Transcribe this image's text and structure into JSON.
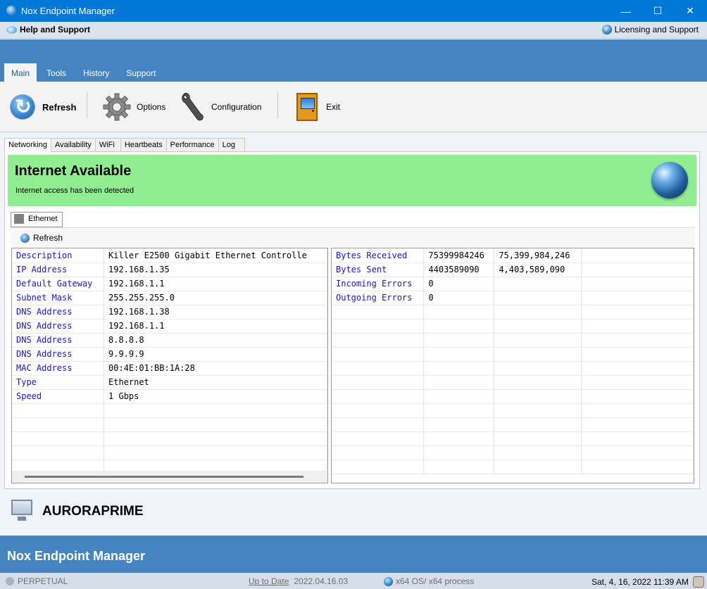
{
  "window": {
    "title": "Nox Endpoint Manager"
  },
  "menubar": {
    "help": "Help and Support",
    "licensing": "Licensing and Support"
  },
  "ribbon_tabs": [
    "Main",
    "Tools",
    "History",
    "Support"
  ],
  "ribbon": {
    "refresh": "Refresh",
    "options": "Options",
    "configuration": "Configuration",
    "exit": "Exit"
  },
  "subtabs": [
    "Networking",
    "Availability",
    "WiFi",
    "Heartbeats",
    "Performance",
    "Log"
  ],
  "banner": {
    "title": "Internet Available",
    "subtitle": "Internet access has been detected",
    "color": "#90ee90"
  },
  "adapter_tab": "Ethernet",
  "inner_refresh": "Refresh",
  "left_table": [
    [
      "Description",
      "Killer E2500 Gigabit Ethernet Controlle"
    ],
    [
      "IP Address",
      "192.168.1.35"
    ],
    [
      "Default Gateway",
      "192.168.1.1"
    ],
    [
      "Subnet Mask",
      "255.255.255.0"
    ],
    [
      "DNS Address",
      "192.168.1.38"
    ],
    [
      "DNS Address",
      "192.168.1.1"
    ],
    [
      "DNS Address",
      "8.8.8.8"
    ],
    [
      "DNS Address",
      "9.9.9.9"
    ],
    [
      "MAC Address",
      "00:4E:01:BB:1A:28"
    ],
    [
      "Type",
      "Ethernet"
    ],
    [
      "Speed",
      "1 Gbps"
    ]
  ],
  "right_table": [
    [
      "Bytes Received",
      "75399984246",
      "75,399,984,246"
    ],
    [
      "Bytes Sent",
      "4403589090",
      "4,403,589,090"
    ],
    [
      "Incoming Errors",
      "0",
      ""
    ],
    [
      "Outgoing Errors",
      "0",
      ""
    ]
  ],
  "hostname": "AURORAPRIME",
  "footer_title": "Nox Endpoint Manager",
  "status": {
    "license": "PERPETUAL",
    "update_link": "Up to Date",
    "version": "2022.04.16.03",
    "platform": "x64 OS/ x64 process",
    "datetime": "Sat, 4, 16, 2022 11:39 AM"
  },
  "colors": {
    "accent": "#0078d7",
    "band": "#4684bf",
    "key_text": "#1a1ab8"
  }
}
